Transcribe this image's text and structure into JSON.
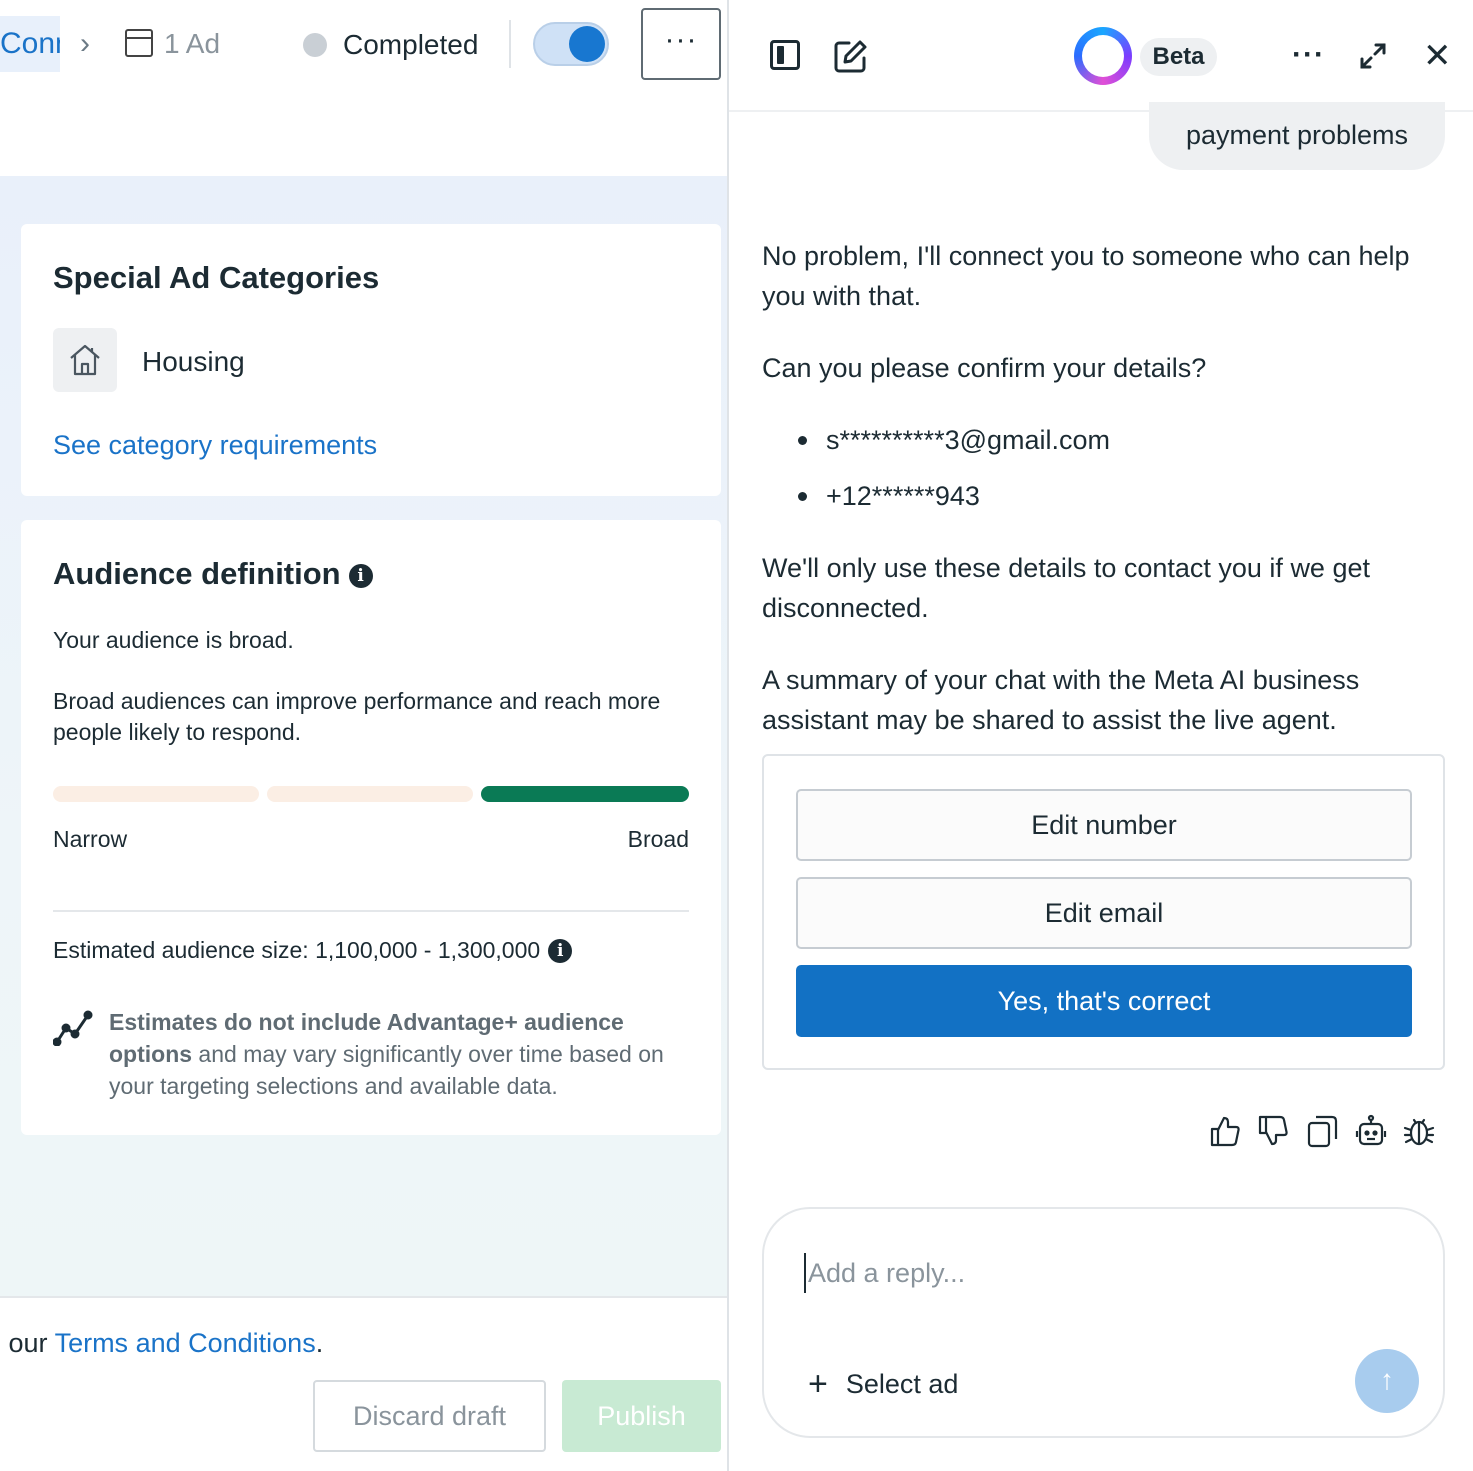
{
  "left": {
    "breadcrumb": {
      "link_text": "Conn",
      "ad_label": "1 Ad"
    },
    "status": {
      "label": "Completed",
      "toggle_on": true
    },
    "more_label": "···",
    "special_categories": {
      "title": "Special Ad Categories",
      "category": "Housing",
      "icon": "house-icon",
      "requirements_link": "See category requirements"
    },
    "audience": {
      "title": "Audience definition",
      "summary": "Your audience is broad.",
      "description": "Broad audiences can improve performance and reach more people likely to respond.",
      "meter": {
        "active_segment": 3,
        "segments": 3
      },
      "narrow_label": "Narrow",
      "broad_label": "Broad",
      "estimated_label": "Estimated audience size: 1,100,000 - 1,300,000",
      "note_bold": "Estimates do not include Advantage+ audience options",
      "note_rest": " and may vary significantly over time based on your targeting selections and available data."
    },
    "footer": {
      "terms_prefix": "o our ",
      "terms_link": "Terms and Conditions",
      "terms_suffix": ".",
      "discard_label": "Discard draft",
      "publish_label": "Publish"
    }
  },
  "assistant": {
    "badge": "Beta",
    "more_label": "···",
    "close_label": "✕",
    "user_message": "payment problems",
    "messages": {
      "connect": "No problem, I'll connect you to someone who can help you with that.",
      "confirm": "Can you please confirm your details?",
      "email": "s**********3@gmail.com",
      "phone": "+12******943",
      "usage": "We'll only use these details to contact you if we get disconnected.",
      "summary": "A summary of your chat with the Meta AI business assistant may be shared to assist the live agent."
    },
    "choices": {
      "edit_number": "Edit number",
      "edit_email": "Edit email",
      "confirm": "Yes, that's correct"
    },
    "composer": {
      "placeholder": "Add a reply...",
      "select_ad": "Select ad",
      "send_label": "↑"
    },
    "colors": {
      "primary": "#1271c4",
      "success": "#0a7a55",
      "link": "#1a73c8"
    }
  }
}
